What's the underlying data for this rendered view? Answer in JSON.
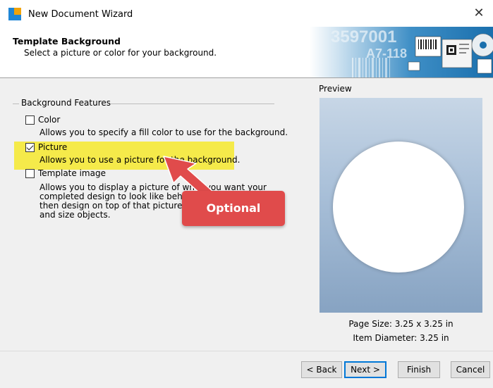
{
  "window": {
    "title": "New Document Wizard",
    "close_glyph": "✕"
  },
  "header": {
    "title": "Template Background",
    "subtitle": "Select a picture or color for your background.",
    "banner": {
      "text1": "3597001",
      "text2": "A7-118"
    }
  },
  "features": {
    "group_label": "Background Features",
    "options": [
      {
        "label": "Color",
        "checked": false,
        "description": [
          "Allows you to specify a fill color to use for the background."
        ]
      },
      {
        "label": "Picture",
        "checked": true,
        "description": [
          "Allows you to use a picture for the background."
        ]
      },
      {
        "label": "Template image",
        "checked": false,
        "description": [
          "Allows you to display a picture of what you want your",
          "completed design to look like behind",
          "then design on top of that picture,",
          "and size objects."
        ]
      }
    ]
  },
  "preview": {
    "label": "Preview",
    "page_size": "Page Size:  3.25 x 3.25 in",
    "item_diameter": "Item Diameter:  3.25 in"
  },
  "annotation": {
    "callout": "Optional",
    "highlight_color": "#f5ea4a",
    "callout_color": "#e04b4b"
  },
  "buttons": {
    "back": "< Back",
    "next": "Next >",
    "finish": "Finish",
    "cancel": "Cancel"
  },
  "colors": {
    "accent": "#0078d7",
    "logo_blue": "#1f86d6",
    "logo_orange": "#f0a30a"
  }
}
